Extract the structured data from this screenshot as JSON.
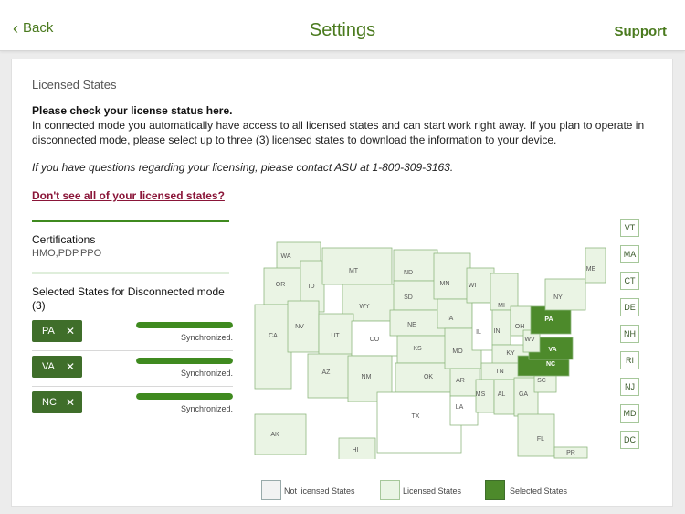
{
  "header": {
    "back_label": "Back",
    "title": "Settings",
    "support_label": "Support"
  },
  "licensed": {
    "section_title": "Licensed States",
    "check_status": "Please check your license status here.",
    "description": "In connected mode you automatically have access to all licensed states and can start work right away. If you plan to operate in disconnected mode, please select up to three (3) licensed states to download the information to your device.",
    "questions": "If you have questions regarding your licensing, please contact ASU at 1-800-309-3163.",
    "missing_link": "Don't see all of your licensed states?"
  },
  "certifications": {
    "label": "Certifications",
    "value": "HMO,PDP,PPO"
  },
  "selected": {
    "label": "Selected States for Disconnected mode (3)",
    "items": [
      {
        "code": "PA",
        "status": "Synchronized.",
        "progress": 1.0
      },
      {
        "code": "VA",
        "status": "Synchronized.",
        "progress": 1.0
      },
      {
        "code": "NC",
        "status": "Synchronized.",
        "progress": 1.0
      }
    ],
    "remove_glyph": "✕"
  },
  "map": {
    "state_labels": [
      "WA",
      "OR",
      "CA",
      "ID",
      "NV",
      "MT",
      "WY",
      "UT",
      "AZ",
      "CO",
      "NM",
      "ND",
      "SD",
      "NE",
      "KS",
      "OK",
      "TX",
      "MN",
      "IA",
      "MO",
      "AR",
      "LA",
      "WI",
      "IL",
      "MI",
      "IN",
      "OH",
      "KY",
      "TN",
      "MS",
      "AL",
      "GA",
      "FL",
      "SC",
      "NC",
      "VA",
      "WV",
      "PA",
      "NY",
      "ME",
      "AK",
      "HI",
      "PR"
    ],
    "small_states": [
      "VT",
      "MA",
      "CT",
      "DE",
      "NH",
      "RI",
      "NJ",
      "MD",
      "DC"
    ],
    "colors": {
      "not_licensed": "#ffffff",
      "licensed": "#eaf4e4",
      "selected": "#4d8a2b",
      "border": "#8fb87f"
    }
  },
  "legend": {
    "not_licensed": "Not licensed States",
    "licensed": "Licensed States",
    "selected": "Selected States"
  },
  "colors": {
    "accent": "#4a7a1e",
    "link": "#8a1538",
    "chip": "#3f6e2a"
  }
}
